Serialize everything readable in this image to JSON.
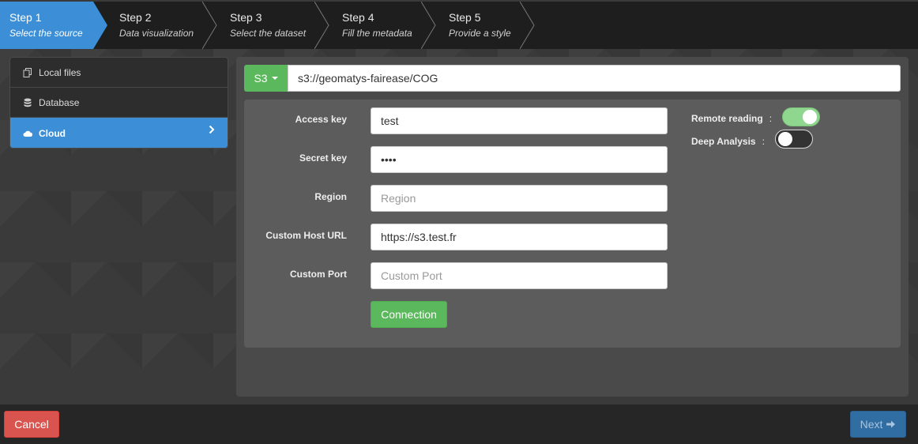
{
  "steps": [
    {
      "num": "Step 1",
      "desc": "Select the source"
    },
    {
      "num": "Step 2",
      "desc": "Data visualization"
    },
    {
      "num": "Step 3",
      "desc": "Select the dataset"
    },
    {
      "num": "Step 4",
      "desc": "Fill the metadata"
    },
    {
      "num": "Step 5",
      "desc": "Provide a style"
    }
  ],
  "active_step": 0,
  "menu": {
    "items": [
      {
        "label": "Local files",
        "icon": "files-icon"
      },
      {
        "label": "Database",
        "icon": "database-icon"
      },
      {
        "label": "Cloud",
        "icon": "cloud-icon"
      }
    ],
    "active": "Cloud"
  },
  "source": {
    "type_label": "S3",
    "url": "s3://geomatys-fairease/COG"
  },
  "form": {
    "access_key": {
      "label": "Access key",
      "value": "test",
      "placeholder": ""
    },
    "secret_key": {
      "label": "Secret key",
      "value": "test",
      "placeholder": ""
    },
    "region": {
      "label": "Region",
      "value": "",
      "placeholder": "Region"
    },
    "custom_host": {
      "label": "Custom Host URL",
      "value": "https://s3.test.fr",
      "placeholder": ""
    },
    "custom_port": {
      "label": "Custom Port",
      "value": "",
      "placeholder": "Custom Port"
    },
    "connection_label": "Connection",
    "remote_reading": {
      "label": "Remote reading",
      "colon": ":",
      "on": true
    },
    "deep_analysis": {
      "label": "Deep Analysis",
      "colon": ":",
      "on": false
    }
  },
  "footer": {
    "cancel_label": "Cancel",
    "next_label": "Next"
  },
  "colors": {
    "accent": "#3c8fd6",
    "success": "#5cb85c",
    "danger": "#d9534f"
  }
}
